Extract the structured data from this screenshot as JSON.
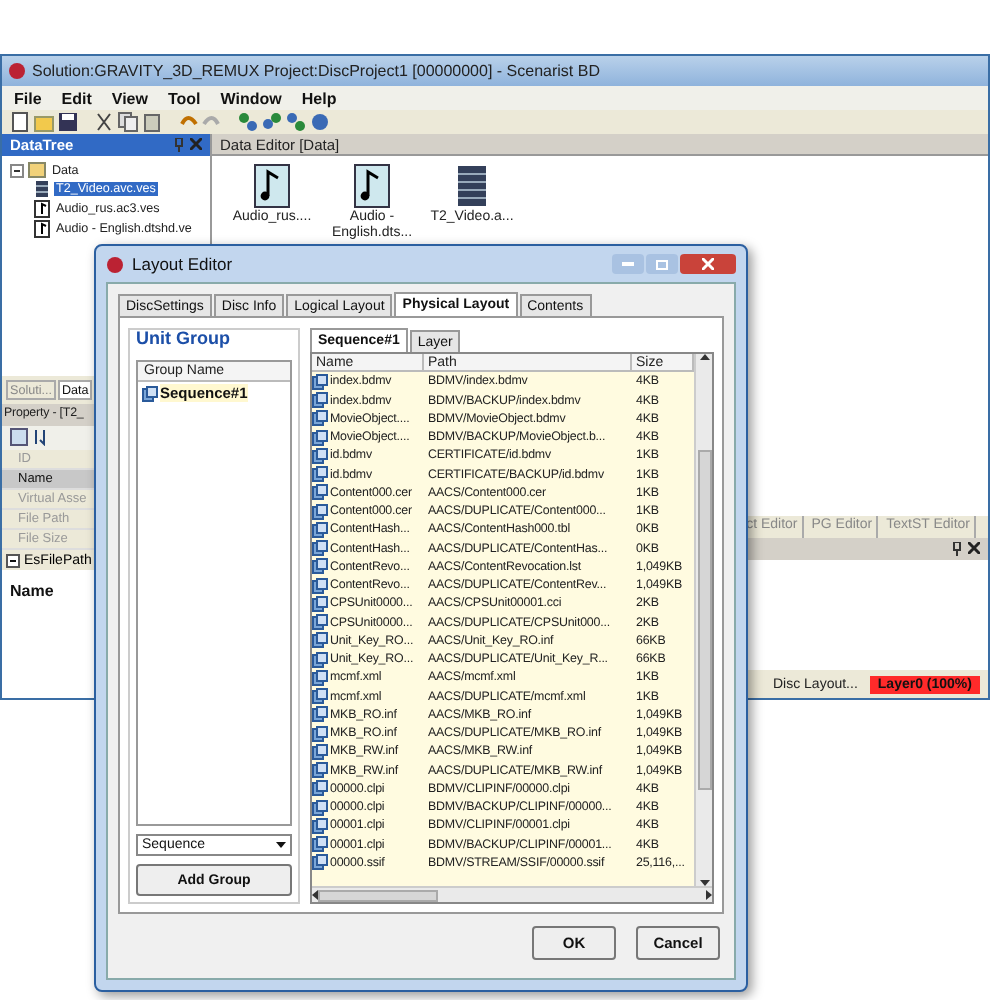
{
  "window": {
    "title": "Solution:GRAVITY_3D_REMUX Project:DiscProject1 [00000000] - Scenarist BD"
  },
  "menu": [
    "File",
    "Edit",
    "View",
    "Tool",
    "Window",
    "Help"
  ],
  "data_tree": {
    "title": "DataTree",
    "root": {
      "label": "Data",
      "expanded": true,
      "children": [
        {
          "label": "T2_Video.avc.ves",
          "kind": "video",
          "selected": true
        },
        {
          "label": "Audio_rus.ac3.ves",
          "kind": "audio",
          "selected": false
        },
        {
          "label": "Audio - English.dtshd.ve",
          "kind": "audio",
          "selected": false
        }
      ]
    }
  },
  "data_editor": {
    "title": "Data Editor [Data]",
    "items": [
      {
        "label": "Audio_rus....",
        "kind": "audio"
      },
      {
        "label": "Audio - English.dts...",
        "kind": "audio"
      },
      {
        "label": "T2_Video.a...",
        "kind": "video"
      }
    ]
  },
  "side_tabs": [
    {
      "label": "Soluti...",
      "selected": false
    },
    {
      "label": "Data",
      "selected": true
    }
  ],
  "property": {
    "title": "Property - [T2_",
    "rows": [
      {
        "label": "ID",
        "selected": false,
        "disabled": true
      },
      {
        "label": "Name",
        "selected": true,
        "disabled": false
      },
      {
        "label": "Virtual Asse",
        "selected": false,
        "disabled": true
      },
      {
        "label": "File Path",
        "selected": false,
        "disabled": true
      },
      {
        "label": "File Size",
        "selected": false,
        "disabled": true
      }
    ],
    "group": {
      "label": "EsFilePath",
      "expanded": true
    },
    "description": "Name"
  },
  "editor_tabs": [
    "ct Editor",
    "PG Editor",
    "TextST Editor"
  ],
  "status_bar": {
    "left": "Disc Layout...",
    "layer": "Layer0 (100%)"
  },
  "dialog": {
    "title": "Layout Editor",
    "tabs": [
      {
        "label": "DiscSettings",
        "selected": false
      },
      {
        "label": "Disc Info",
        "selected": false
      },
      {
        "label": "Logical Layout",
        "selected": false
      },
      {
        "label": "Physical Layout",
        "selected": true
      },
      {
        "label": "Contents",
        "selected": false
      }
    ],
    "unit_group": {
      "title": "Unit Group",
      "column": "Group Name",
      "items": [
        {
          "label": "Sequence#1",
          "selected": true
        }
      ],
      "dropdown": "Sequence",
      "button": "Add Group"
    },
    "sub_tabs": [
      {
        "label": "Sequence#1",
        "selected": true
      },
      {
        "label": "Layer",
        "selected": false
      }
    ],
    "columns": [
      "Name",
      "Path",
      "Size"
    ],
    "rows": [
      [
        "index.bdmv",
        "BDMV/index.bdmv",
        "4KB"
      ],
      [
        "index.bdmv",
        "BDMV/BACKUP/index.bdmv",
        "4KB"
      ],
      [
        "MovieObject....",
        "BDMV/MovieObject.bdmv",
        "4KB"
      ],
      [
        "MovieObject....",
        "BDMV/BACKUP/MovieObject.b...",
        "4KB"
      ],
      [
        "id.bdmv",
        "CERTIFICATE/id.bdmv",
        "1KB"
      ],
      [
        "id.bdmv",
        "CERTIFICATE/BACKUP/id.bdmv",
        "1KB"
      ],
      [
        "Content000.cer",
        "AACS/Content000.cer",
        "1KB"
      ],
      [
        "Content000.cer",
        "AACS/DUPLICATE/Content000...",
        "1KB"
      ],
      [
        "ContentHash...",
        "AACS/ContentHash000.tbl",
        "0KB"
      ],
      [
        "ContentHash...",
        "AACS/DUPLICATE/ContentHas...",
        "0KB"
      ],
      [
        "ContentRevo...",
        "AACS/ContentRevocation.lst",
        "1,049KB"
      ],
      [
        "ContentRevo...",
        "AACS/DUPLICATE/ContentRev...",
        "1,049KB"
      ],
      [
        "CPSUnit0000...",
        "AACS/CPSUnit00001.cci",
        "2KB"
      ],
      [
        "CPSUnit0000...",
        "AACS/DUPLICATE/CPSUnit000...",
        "2KB"
      ],
      [
        "Unit_Key_RO...",
        "AACS/Unit_Key_RO.inf",
        "66KB"
      ],
      [
        "Unit_Key_RO...",
        "AACS/DUPLICATE/Unit_Key_R...",
        "66KB"
      ],
      [
        "mcmf.xml",
        "AACS/mcmf.xml",
        "1KB"
      ],
      [
        "mcmf.xml",
        "AACS/DUPLICATE/mcmf.xml",
        "1KB"
      ],
      [
        "MKB_RO.inf",
        "AACS/MKB_RO.inf",
        "1,049KB"
      ],
      [
        "MKB_RO.inf",
        "AACS/DUPLICATE/MKB_RO.inf",
        "1,049KB"
      ],
      [
        "MKB_RW.inf",
        "AACS/MKB_RW.inf",
        "1,049KB"
      ],
      [
        "MKB_RW.inf",
        "AACS/DUPLICATE/MKB_RW.inf",
        "1,049KB"
      ],
      [
        "00000.clpi",
        "BDMV/CLIPINF/00000.clpi",
        "4KB"
      ],
      [
        "00000.clpi",
        "BDMV/BACKUP/CLIPINF/00000...",
        "4KB"
      ],
      [
        "00001.clpi",
        "BDMV/CLIPINF/00001.clpi",
        "4KB"
      ],
      [
        "00001.clpi",
        "BDMV/BACKUP/CLIPINF/00001...",
        "4KB"
      ],
      [
        "00000.ssif",
        "BDMV/STREAM/SSIF/00000.ssif",
        "25,116,..."
      ]
    ],
    "buttons": [
      "OK",
      "Cancel"
    ]
  }
}
